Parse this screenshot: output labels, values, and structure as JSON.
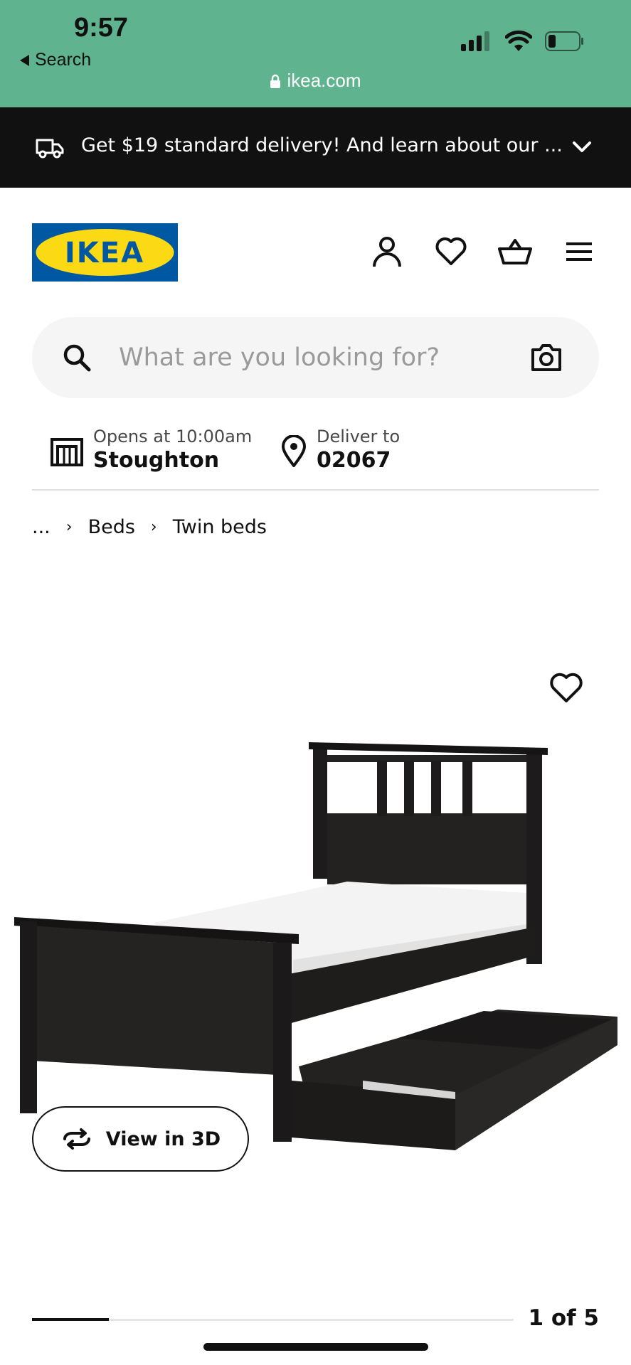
{
  "status_bar": {
    "time": "9:57",
    "back_label": "Search",
    "url": "ikea.com",
    "bg_color": "#5fb48f"
  },
  "promo": {
    "text": "Get $19 standard delivery! And learn about our ...",
    "icon": "truck-icon"
  },
  "header": {
    "logo_text": "IKEA",
    "icons": [
      "profile-icon",
      "heart-icon",
      "basket-icon",
      "hamburger-menu-icon"
    ]
  },
  "search": {
    "placeholder": "What are you looking for?",
    "value": ""
  },
  "store": {
    "label": "Opens at 10:00am",
    "name": "Stoughton"
  },
  "deliver": {
    "label": "Deliver to",
    "zip": "02067"
  },
  "breadcrumb": {
    "items": [
      "...",
      "Beds",
      "Twin beds"
    ]
  },
  "product_image": {
    "view3d_label": "View in 3D"
  },
  "carousel": {
    "counter": "1 of 5",
    "current": 1,
    "total": 5
  }
}
